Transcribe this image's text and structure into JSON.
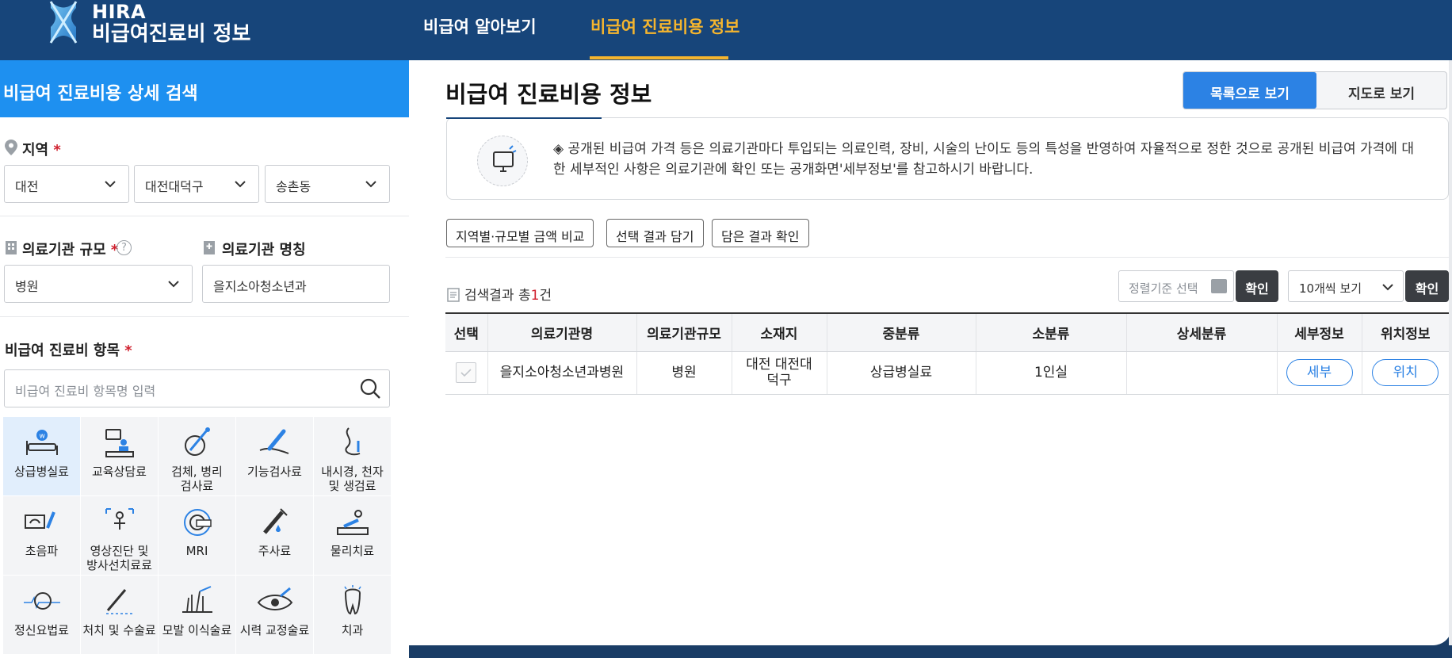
{
  "header": {
    "logo_title": "HIRA",
    "logo_subtitle": "비급여진료비 정보",
    "nav": [
      {
        "label": "비급여 알아보기",
        "active": false
      },
      {
        "label": "비급여 진료비용 정보",
        "active": true
      }
    ],
    "accent_color": "#f5b52e",
    "bar_color": "#17457a"
  },
  "sidebar": {
    "title": "비급여 진료비용 상세 검색",
    "region": {
      "label": "지역",
      "required": "*",
      "province": "대전",
      "district": "대전대덕구",
      "town": "송촌동"
    },
    "scale": {
      "label": "의료기관 규모",
      "required": "*",
      "help": "?",
      "value": "병원"
    },
    "name": {
      "label": "의료기관 명칭",
      "value": "을지소아청소년과"
    },
    "items": {
      "label": "비급여 진료비 항목",
      "required": "*",
      "search_placeholder": "비급여 진료비 항목명 입력"
    },
    "categories": [
      {
        "label": "상급병실료",
        "icon": "hospital-bed-icon",
        "selected": true
      },
      {
        "label": "교육상담료",
        "icon": "counseling-icon",
        "selected": false
      },
      {
        "label": "검체, 병리\n검사료",
        "icon": "specimen-test-icon",
        "selected": false
      },
      {
        "label": "기능검사료",
        "icon": "function-test-icon",
        "selected": false
      },
      {
        "label": "내시경, 천자\n및 생검료",
        "icon": "endoscope-icon",
        "selected": false
      },
      {
        "label": "초음파",
        "icon": "ultrasound-icon",
        "selected": false
      },
      {
        "label": "영상진단 및\n방사선치료료",
        "icon": "radiology-icon",
        "selected": false
      },
      {
        "label": "MRI",
        "icon": "mri-icon",
        "selected": false
      },
      {
        "label": "주사료",
        "icon": "syringe-icon",
        "selected": false
      },
      {
        "label": "물리치료",
        "icon": "physical-therapy-icon",
        "selected": false
      },
      {
        "label": "정신요법료",
        "icon": "brain-wave-icon",
        "selected": false
      },
      {
        "label": "처치 및 수술료",
        "icon": "surgery-icon",
        "selected": false
      },
      {
        "label": "모발 이식술료",
        "icon": "hair-transplant-icon",
        "selected": false
      },
      {
        "label": "시력 교정술료",
        "icon": "eye-icon",
        "selected": false
      },
      {
        "label": "치과",
        "icon": "tooth-icon",
        "selected": false
      }
    ]
  },
  "main": {
    "title": "비급여 진료비용 정보",
    "view_list": "목록으로 보기",
    "view_map": "지도로 보기",
    "notice": "◈ 공개된 비급여 가격 등은 의료기관마다 투입되는 의료인력, 장비, 시술의 난이도 등의 특성을 반영하여 자율적으로 정한 것으로 공개된 비급여 가격에 대한 세부적인 사항은 의료기관에 확인 또는 공개화면'세부정보'를 참고하시기 바랍니다.",
    "actions": [
      "지역별·규모별 금액 비교",
      "선택 결과 담기",
      "담은 결과 확인"
    ],
    "result_prefix": "검색결과 총",
    "result_count": "1",
    "result_suffix": "건",
    "sort_placeholder": "정렬기준 선택",
    "confirm": "확인",
    "per_page": "10개씩 보기",
    "table": {
      "headers": [
        "선택",
        "의료기관명",
        "의료기관규모",
        "소재지",
        "중분류",
        "소분류",
        "상세분류",
        "세부정보",
        "위치정보"
      ],
      "rows": [
        {
          "hospital": "을지소아청소년과병원",
          "scale": "병원",
          "location": "대전 대전대덕구",
          "mid": "상급병실료",
          "small": "1인실",
          "detail_cat": "",
          "detail_btn": "세부",
          "location_btn": "위치"
        }
      ]
    },
    "primary_color": "#2c82e4"
  }
}
